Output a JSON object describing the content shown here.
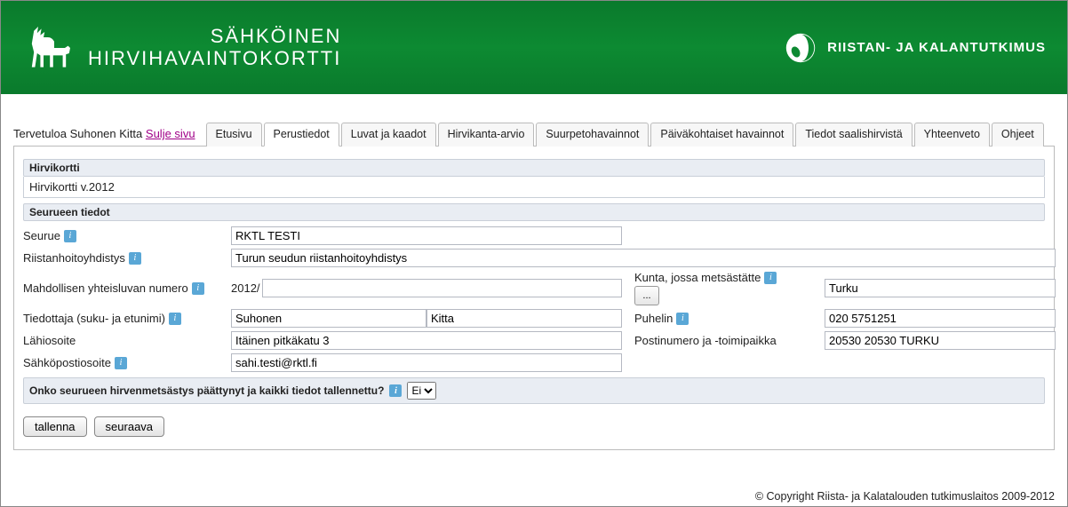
{
  "header": {
    "title_line1": "SÄHKÖINEN",
    "title_line2": "HIRVIHAVAINTOKORTTI",
    "org": "RIISTAN- JA KALANTUTKIMUS"
  },
  "welcome": {
    "prefix": "Tervetuloa ",
    "user": "Suhonen Kitta",
    "close": "Sulje sivu"
  },
  "tabs": {
    "etusivu": "Etusivu",
    "perustiedot": "Perustiedot",
    "luvat": "Luvat ja kaadot",
    "hirvikanta": "Hirvikanta-arvio",
    "suurpeto": "Suurpetohavainnot",
    "paiva": "Päiväkohtaiset havainnot",
    "saalis": "Tiedot saalishirvistä",
    "yhteenveto": "Yhteenveto",
    "ohjeet": "Ohjeet"
  },
  "sections": {
    "hirvikortti_head": "Hirvikortti",
    "hirvikortti_value": "Hirvikortti v.2012",
    "seurue_head": "Seurueen tiedot"
  },
  "labels": {
    "seurue": "Seurue",
    "rhy": "Riistanhoitoyhdistys",
    "yhteislupa": "Mahdollisen yhteisluvan numero",
    "yhteislupa_prefix": "2012/",
    "kunta": "Kunta, jossa metsästätte",
    "tiedottaja": "Tiedottaja (suku- ja etunimi)",
    "puhelin": "Puhelin",
    "lahiosoite": "Lähiosoite",
    "postinumero": "Postinumero ja -toimipaikka",
    "email": "Sähköpostiosoite",
    "question": "Onko seurueen hirvenmetsästys päättynyt ja kaikki tiedot tallennettu?",
    "browse": "..."
  },
  "values": {
    "seurue": "RKTL TESTI",
    "rhy": "Turun seudun riistanhoitoyhdistys",
    "yhteislupa": "",
    "kunta": "Turku",
    "suku": "Suhonen",
    "etu": "Kitta",
    "puhelin": "020 5751251",
    "lahiosoite": "Itäinen pitkäkatu 3",
    "postinumero": "20530 20530 TURKU",
    "email": "sahi.testi@rktl.fi",
    "question_selected": "Ei"
  },
  "buttons": {
    "save": "tallenna",
    "next": "seuraava"
  },
  "footer": "© Copyright Riista- ja Kalatalouden tutkimuslaitos 2009-2012"
}
